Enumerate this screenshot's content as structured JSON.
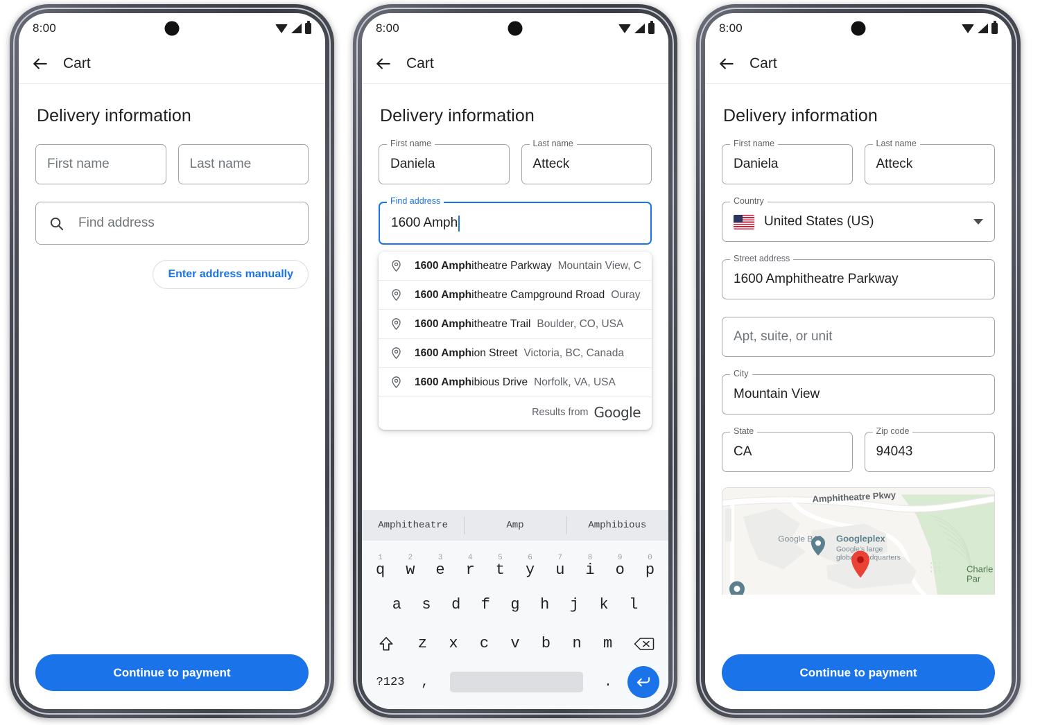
{
  "theme": {
    "accent": "#1a73e8",
    "text_primary": "#1f1f1f",
    "text_secondary": "#5f6368",
    "border": "#a0a3a8",
    "marker_red": "#ea4335",
    "poi_teal": "#5b7f8c"
  },
  "status_bar": {
    "time": "8:00",
    "wifi_icon": "wifi-icon",
    "signal_icon": "cellular-signal-icon",
    "battery_icon": "battery-icon",
    "camera_icon": "front-camera-punch-hole"
  },
  "app_bar": {
    "back_icon": "back-arrow-icon",
    "title": "Cart"
  },
  "section": {
    "title": "Delivery information"
  },
  "panel1": {
    "first_name": {
      "label": "First name",
      "value": "",
      "placeholder": "First name"
    },
    "last_name": {
      "label": "Last name",
      "value": "",
      "placeholder": "Last name"
    },
    "find_address": {
      "placeholder": "Find address",
      "icon": "search-icon"
    },
    "manual_chip": "Enter address manually",
    "cta": "Continue to payment"
  },
  "panel2": {
    "first_name": {
      "label": "First name",
      "value": "Daniela"
    },
    "last_name": {
      "label": "Last name",
      "value": "Atteck"
    },
    "find_address": {
      "label": "Find address",
      "value": "1600 Amph",
      "focused": true
    },
    "suggestions": [
      {
        "icon": "location-pin-icon",
        "bold": "1600 Amph",
        "rest": "itheatre Parkway",
        "secondary": "Mountain View, C..."
      },
      {
        "icon": "location-pin-icon",
        "bold": "1600 Amph",
        "rest": "itheatre Campground Rroad",
        "secondary": "Ouray, ..."
      },
      {
        "icon": "location-pin-icon",
        "bold": "1600 Amph",
        "rest": "itheatre Trail",
        "secondary": "Boulder, CO, USA"
      },
      {
        "icon": "location-pin-icon",
        "bold": "1600 Amph",
        "rest": "ion Street",
        "secondary": "Victoria, BC, Canada"
      },
      {
        "icon": "location-pin-icon",
        "bold": "1600 Amph",
        "rest": "ibious Drive",
        "secondary": "Norfolk, VA, USA"
      }
    ],
    "attribution": {
      "text": "Results from",
      "brand": "Google"
    },
    "keyboard": {
      "suggestions": [
        "Amphitheatre",
        "Amp",
        "Amphibious"
      ],
      "row1_numbers": [
        "1",
        "2",
        "3",
        "4",
        "5",
        "6",
        "7",
        "8",
        "9",
        "0"
      ],
      "row1": [
        "q",
        "w",
        "e",
        "r",
        "t",
        "y",
        "u",
        "i",
        "o",
        "p"
      ],
      "row2": [
        "a",
        "s",
        "d",
        "f",
        "g",
        "h",
        "j",
        "k",
        "l"
      ],
      "row3": [
        "z",
        "x",
        "c",
        "v",
        "b",
        "n",
        "m"
      ],
      "shift_icon": "shift-key-icon",
      "backspace_icon": "backspace-key-icon",
      "symbols_key": "?123",
      "comma_key": ",",
      "period_key": ".",
      "space_key": "space-bar",
      "enter_icon": "enter-key-icon"
    }
  },
  "panel3": {
    "first_name": {
      "label": "First name",
      "value": "Daniela"
    },
    "last_name": {
      "label": "Last name",
      "value": "Atteck"
    },
    "country": {
      "label": "Country",
      "value": "United States (US)",
      "flag": "us-flag-icon",
      "chevron": "chevron-down-icon"
    },
    "street": {
      "label": "Street address",
      "value": "1600 Amphitheatre Parkway"
    },
    "apt": {
      "label": "",
      "value": "",
      "placeholder": "Apt, suite, or unit"
    },
    "city": {
      "label": "City",
      "value": "Mountain View"
    },
    "state": {
      "label": "State",
      "value": "CA"
    },
    "zip": {
      "label": "Zip code",
      "value": "94043"
    },
    "map": {
      "road_label": "Amphitheatre Pkwy",
      "building_label": "Google B40",
      "poi_title": "Googleplex",
      "poi_sub_line1": "Google's large",
      "poi_sub_line2": "global headquarters",
      "park_label_line1": "Charle",
      "park_label_line2": "Par",
      "marker_icon": "map-marker-icon",
      "poi_pin_icon": "map-poi-pin-icon"
    },
    "cta": "Continue to payment"
  }
}
